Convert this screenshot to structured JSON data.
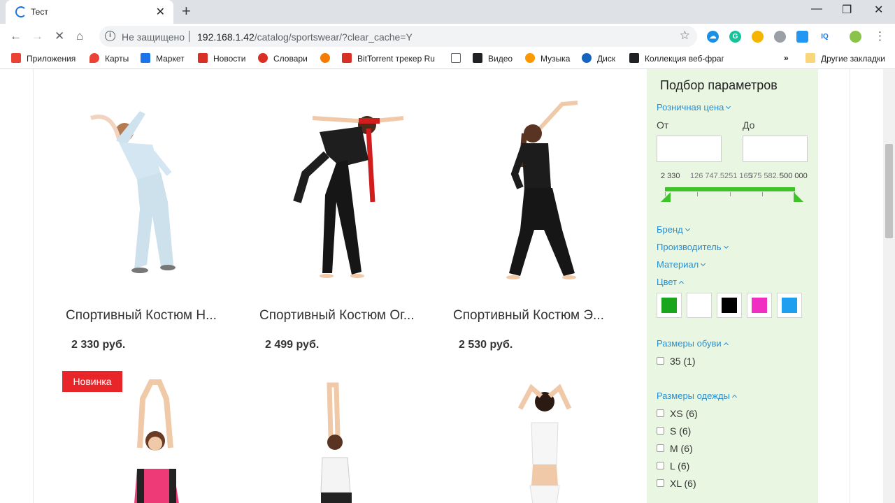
{
  "browser": {
    "tab_title": "Тест",
    "address_insecure": "Не защищено",
    "address_host": "192.168.1.42",
    "address_path": "/catalog/sportswear/?clear_cache=Y",
    "bookmarks": [
      {
        "label": "Приложения",
        "color": "#ea4335"
      },
      {
        "label": "Карты",
        "color": "#ea4335"
      },
      {
        "label": "Маркет",
        "color": "#1a73e8"
      },
      {
        "label": "Новости",
        "color": "#d93025"
      },
      {
        "label": "Словари",
        "color": "#d93025"
      },
      {
        "label": "",
        "color": "#f57c00"
      },
      {
        "label": "BitTorrent трекер Ru",
        "color": "#d93025"
      },
      {
        "label": "",
        "color": "#ffffff"
      },
      {
        "label": "Видео",
        "color": "#202124"
      },
      {
        "label": "Музыка",
        "color": "#ff9800"
      },
      {
        "label": "Диск",
        "color": "#1565c0"
      },
      {
        "label": "Коллекция веб-фраг",
        "color": "#202124"
      }
    ],
    "bookmarks_more": "»",
    "other_bookmarks": "Другие закладки"
  },
  "products": [
    {
      "name": "Спортивный Костюм Н...",
      "price": "2 330 руб.",
      "image": "woman-stretching-light-blue-suit"
    },
    {
      "name": "Спортивный Костюм Ог...",
      "price": "2 499 руб.",
      "image": "woman-bending-black-suit-red-scarf"
    },
    {
      "name": "Спортивный Костюм Э...",
      "price": "2 530 руб.",
      "image": "woman-stretching-black-suit"
    },
    {
      "name": "",
      "price": "",
      "image": "woman-arms-up-pink-top",
      "badge": "Новинка"
    },
    {
      "name": "",
      "price": "",
      "image": "woman-arms-up-white-top"
    },
    {
      "name": "",
      "price": "",
      "image": "woman-hands-behind-head-white"
    }
  ],
  "filter": {
    "title": "Подбор параметров",
    "price_label": "Розничная цена",
    "from_label": "От",
    "to_label": "До",
    "from_value": "",
    "to_value": "",
    "scale": [
      "2 330",
      "126 747.5",
      "251 165",
      "375 582.5",
      "500 000"
    ],
    "brand_label": "Бренд",
    "maker_label": "Производитель",
    "material_label": "Материал",
    "color_label": "Цвет",
    "colors": [
      "#19a51c",
      "#ffffff",
      "#000000",
      "#f02fc2",
      "#1f9ff0"
    ],
    "shoe_sizes_label": "Размеры обуви",
    "shoe_sizes": [
      "35 (1)"
    ],
    "clothes_sizes_label": "Размеры одежды",
    "clothes_sizes": [
      "XS (6)",
      "S (6)",
      "M (6)",
      "L (6)",
      "XL (6)"
    ]
  }
}
